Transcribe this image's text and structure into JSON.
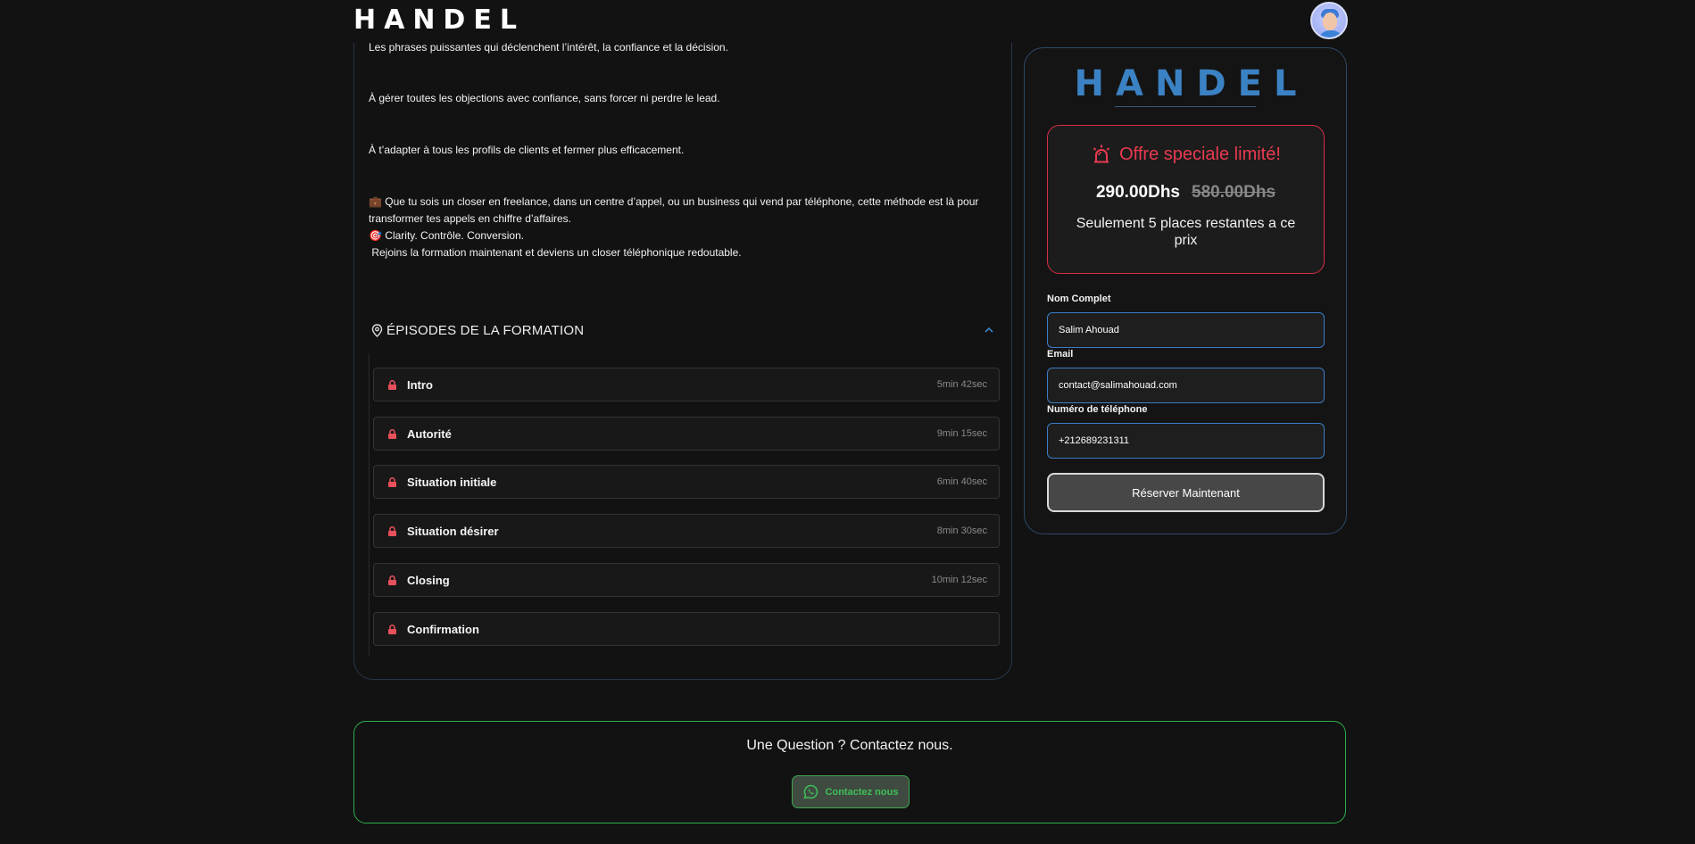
{
  "header": {
    "logo": "HANDEL"
  },
  "content": {
    "p1": "Les phrases puissantes qui déclenchent l’intérêt, la confiance et la décision.",
    "p2": "À gérer toutes les objections avec confiance, sans forcer ni perdre le lead.",
    "p3": "À t’adapter à tous les profils de clients et fermer plus efficacement.",
    "p4a": "💼 Que tu sois un closer en freelance, dans un centre d’appel, ou un business qui vend par téléphone, cette méthode est là pour transformer tes appels en chiffre d’affaires.",
    "p4b": "🎯 Clarity. Contrôle. Conversion.",
    "p4c": " Rejoins la formation maintenant et deviens un closer téléphonique redoutable."
  },
  "episodes": {
    "title": "ÉPISODES DE LA FORMATION",
    "items": [
      {
        "title": "Intro",
        "duration": "5min 42sec"
      },
      {
        "title": "Autorité",
        "duration": "9min 15sec"
      },
      {
        "title": "Situation initiale",
        "duration": "6min 40sec"
      },
      {
        "title": "Situation désirer",
        "duration": "8min 30sec"
      },
      {
        "title": "Closing",
        "duration": "10min 12sec"
      },
      {
        "title": "Confirmation",
        "duration": ""
      }
    ]
  },
  "offer": {
    "logo": "HANDEL",
    "title": "Offre speciale limité!",
    "price_new": "290.00Dhs",
    "price_old": "580.00Dhs",
    "places": "Seulement 5 places restantes a ce prix"
  },
  "form": {
    "name_label": "Nom Complet",
    "name_value": "Salim Ahouad",
    "email_label": "Email",
    "email_value": "contact@salimahouad.com",
    "phone_label": "Numéro de téléphone",
    "phone_value": "+212689231311",
    "submit": "Réserver Maintenant"
  },
  "contact": {
    "question": "Une Question ? Contactez nous.",
    "button": "Contactez nous"
  },
  "colors": {
    "accent_blue": "#3b82c4",
    "alert_red": "#ea3a4f",
    "whatsapp_green": "#3fbf5a"
  }
}
